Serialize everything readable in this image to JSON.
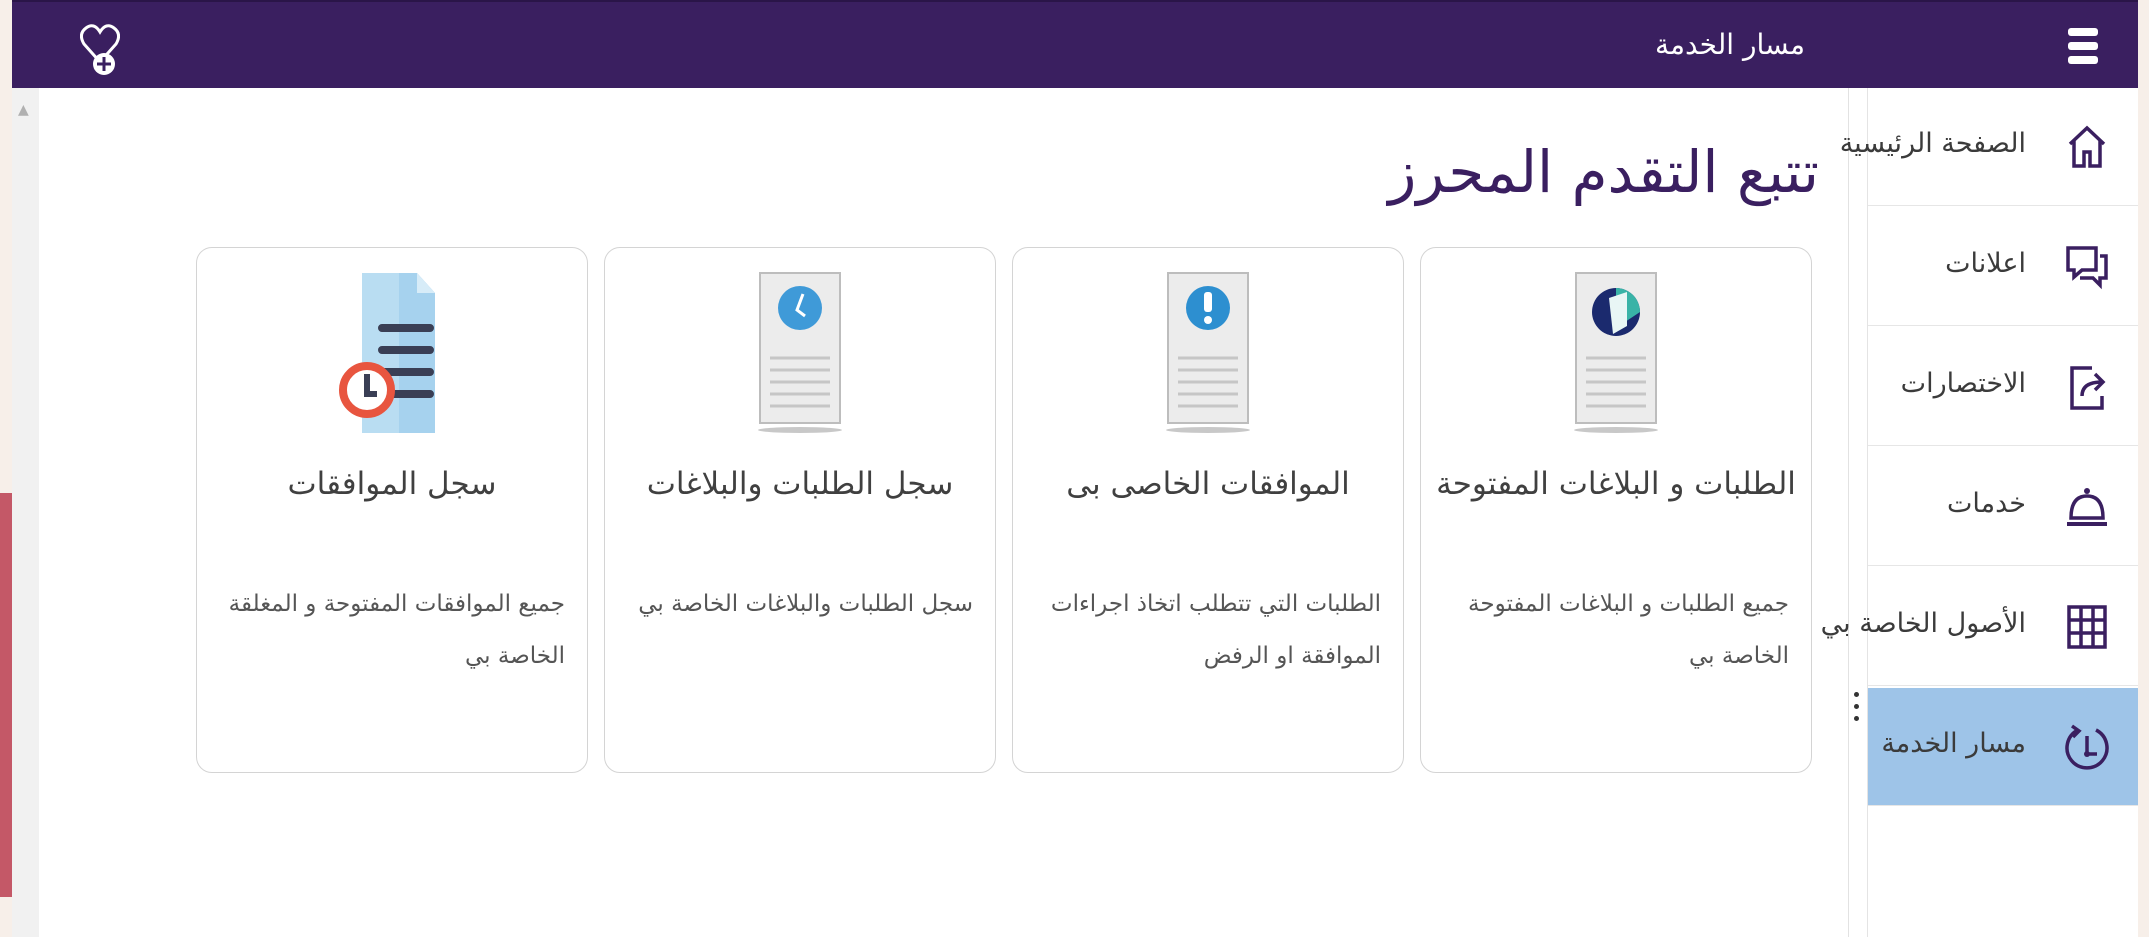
{
  "header": {
    "title": "مسار الخدمة"
  },
  "sidebar": {
    "items": [
      {
        "label": "الصفحة الرئيسية",
        "icon": "home-icon"
      },
      {
        "label": "اعلانات",
        "icon": "chat-bubbles-icon"
      },
      {
        "label": "الاختصارات",
        "icon": "shortcut-icon"
      },
      {
        "label": "خدمات",
        "icon": "service-bell-icon"
      },
      {
        "label": "الأصول الخاصة بي",
        "icon": "grid-icon"
      },
      {
        "label": "مسار الخدمة",
        "icon": "service-path-icon",
        "active": true
      }
    ]
  },
  "main": {
    "title": "تتبع التقدم المحرز",
    "cards": [
      {
        "title": "الطلبات و البلاغات المفتوحة",
        "description": "جميع الطلبات و البلاغات المفتوحة الخاصة بي",
        "icon": "open-requests-document-icon"
      },
      {
        "title": "الموافقات الخاصى بى",
        "description": "الطلبات التي تتطلب اتخاذ اجراءات الموافقة او الرفض",
        "icon": "approvals-alert-document-icon"
      },
      {
        "title": "سجل الطلبات والبلاغات",
        "description": "سجل الطلبات والبلاغات الخاصة بي",
        "icon": "history-clock-document-icon"
      },
      {
        "title": "سجل الموافقات",
        "description": "جميع الموافقات المفتوحة و المغلقة الخاصة بي",
        "icon": "approval-log-document-icon"
      }
    ]
  },
  "colors": {
    "header_bg": "#3a1f60",
    "active_item_bg": "#9ec4e8",
    "accent_red": "#c45867"
  }
}
